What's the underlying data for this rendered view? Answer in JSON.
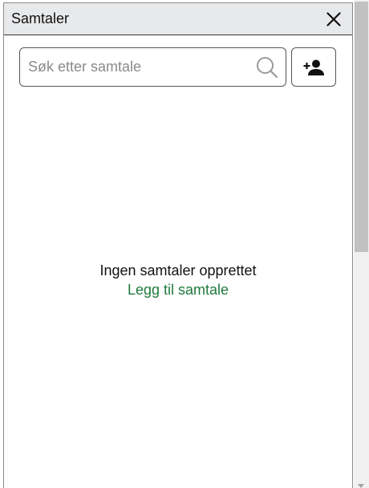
{
  "panel": {
    "title": "Samtaler"
  },
  "search": {
    "placeholder": "Søk etter samtale",
    "value": ""
  },
  "icons": {
    "close": "close-icon",
    "search": "search-icon",
    "add_person": "person-add-icon"
  },
  "empty_state": {
    "message": "Ingen samtaler opprettet",
    "link_label": "Legg til samtale"
  },
  "colors": {
    "header_bg": "#e8e9eb",
    "link": "#1e7a3c",
    "border": "#555555"
  }
}
